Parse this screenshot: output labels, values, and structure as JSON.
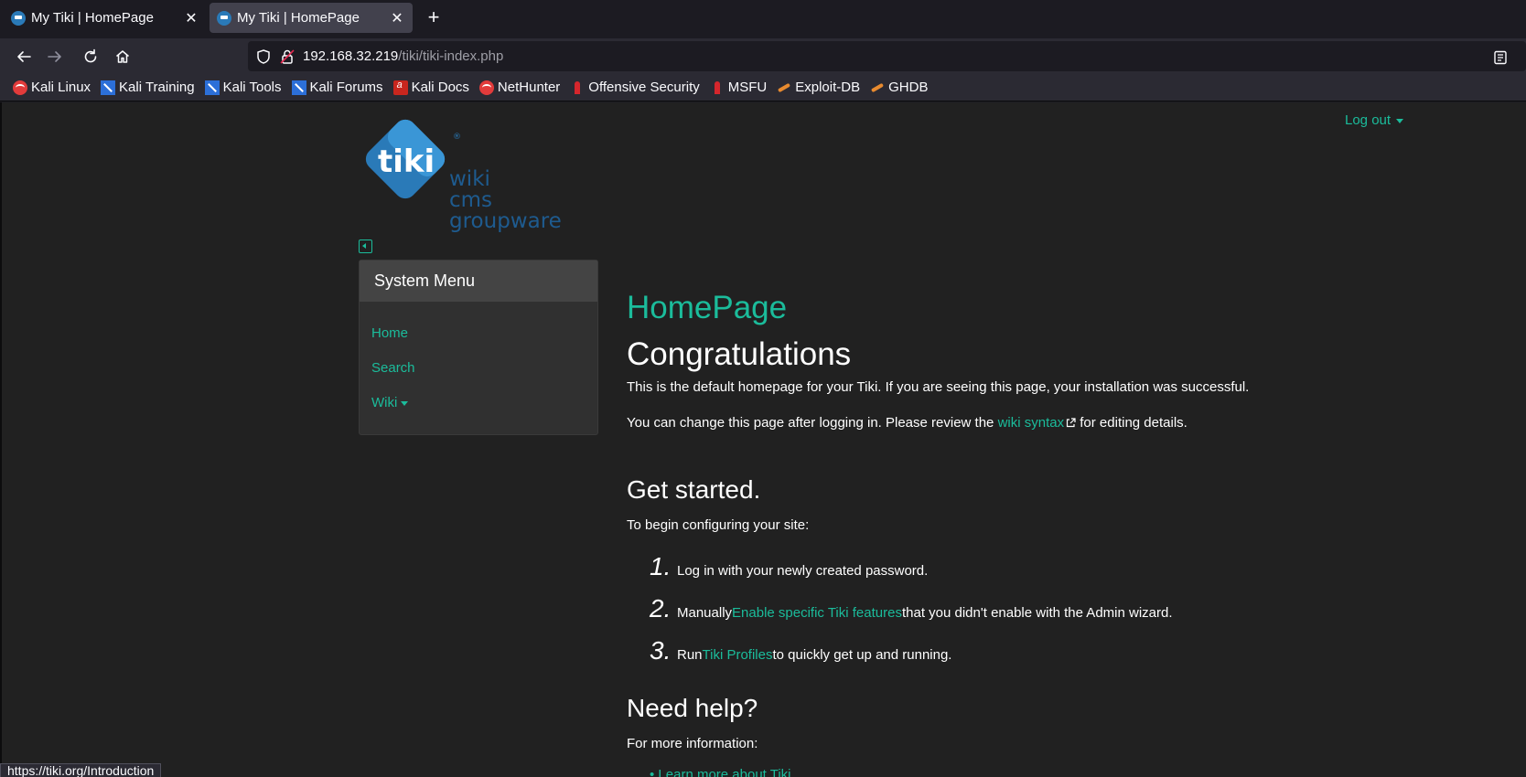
{
  "browser": {
    "tabs": [
      {
        "title": "My Tiki | HomePage",
        "active": false
      },
      {
        "title": "My Tiki | HomePage",
        "active": true
      }
    ],
    "new_tab_label": "+",
    "url_host": "192.168.32.219",
    "url_path": "/tiki/tiki-index.php",
    "bookmarks": [
      {
        "label": "Kali Linux",
        "icon": "kali-dragon-icon"
      },
      {
        "label": "Kali Training",
        "icon": "kali-tools-icon"
      },
      {
        "label": "Kali Tools",
        "icon": "kali-tools-icon"
      },
      {
        "label": "Kali Forums",
        "icon": "kali-tools-icon"
      },
      {
        "label": "Kali Docs",
        "icon": "kali-docs-icon"
      },
      {
        "label": "NetHunter",
        "icon": "kali-dragon-icon"
      },
      {
        "label": "Offensive Security",
        "icon": "offsec-icon"
      },
      {
        "label": "MSFU",
        "icon": "offsec-icon"
      },
      {
        "label": "Exploit-DB",
        "icon": "exploit-db-icon"
      },
      {
        "label": "GHDB",
        "icon": "exploit-db-icon"
      }
    ],
    "status_url": "https://tiki.org/Introduction"
  },
  "site": {
    "logo_word": "tiki",
    "logo_tagline": [
      "wiki",
      "cms",
      "groupware"
    ],
    "logout_label": "Log out"
  },
  "sidebar": {
    "title": "System Menu",
    "items": [
      {
        "label": "Home"
      },
      {
        "label": "Search"
      },
      {
        "label": "Wiki"
      }
    ]
  },
  "main": {
    "page_title": "HomePage",
    "heading": "Congratulations",
    "intro": "This is the default homepage for your Tiki. If you are seeing this page, your installation was successful.",
    "change_before": "You can change this page after logging in. Please review the ",
    "wiki_syntax_link": "wiki syntax",
    "change_after": " for editing details.",
    "get_started_heading": "Get started.",
    "get_started_intro": "To begin configuring your site:",
    "steps": [
      {
        "num": "1.",
        "before": "Log in with your newly created password.",
        "link": "",
        "after": ""
      },
      {
        "num": "2.",
        "before": "Manually ",
        "link": "Enable specific Tiki features",
        "after": " that you didn't enable with the Admin wizard."
      },
      {
        "num": "3.",
        "before": "Run ",
        "link": "Tiki Profiles",
        "after": " to quickly get up and running."
      }
    ],
    "help_heading": "Need help?",
    "help_intro": "For more information:",
    "learn_link": "Learn more about Tiki"
  },
  "colors": {
    "accent": "#1bbc9b",
    "page_bg": "#212121",
    "logo_blue": "#1e5b8f"
  }
}
